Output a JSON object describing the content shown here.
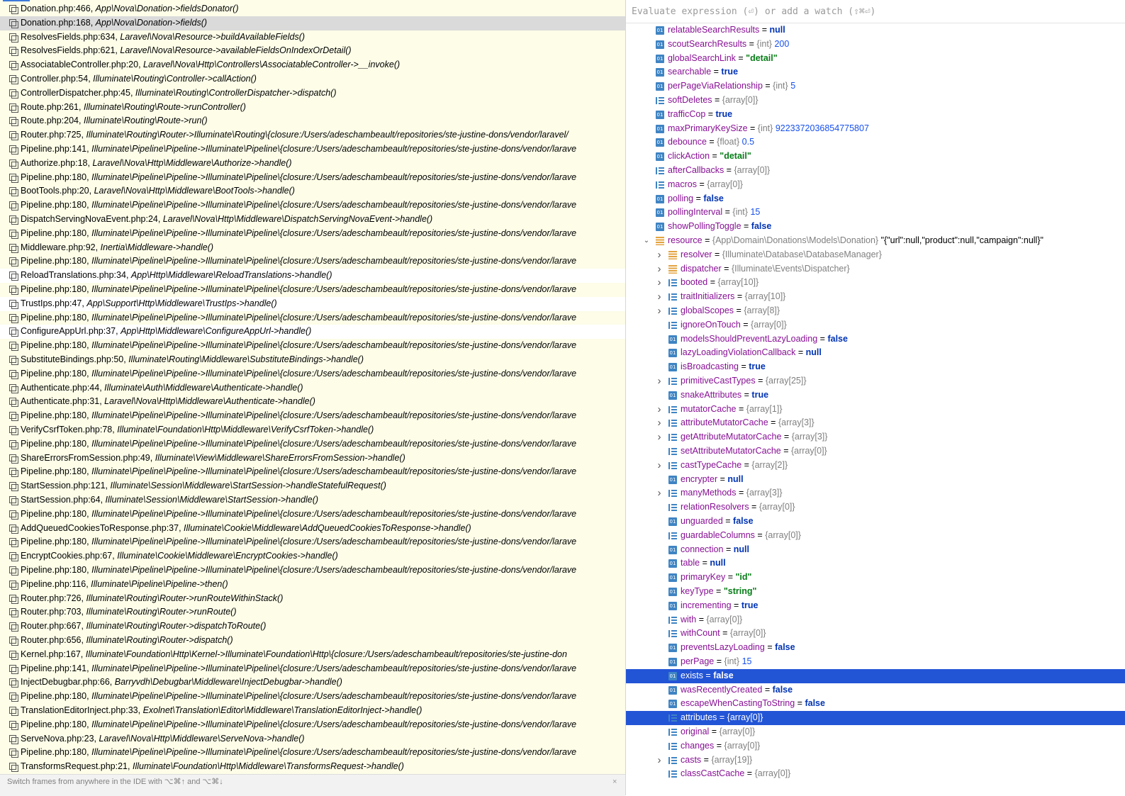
{
  "frames": [
    {
      "file": "Donation.php:466,",
      "method": "App\\Nova\\Donation->fieldsDonator()"
    },
    {
      "file": "Donation.php:168,",
      "method": "App\\Nova\\Donation->fields()",
      "selected": true
    },
    {
      "file": "ResolvesFields.php:634,",
      "method": "Laravel\\Nova\\Resource->buildAvailableFields()"
    },
    {
      "file": "ResolvesFields.php:621,",
      "method": "Laravel\\Nova\\Resource->availableFieldsOnIndexOrDetail()"
    },
    {
      "file": "AssociatableController.php:20,",
      "method": "Laravel\\Nova\\Http\\Controllers\\AssociatableController->__invoke()"
    },
    {
      "file": "Controller.php:54,",
      "method": "Illuminate\\Routing\\Controller->callAction()"
    },
    {
      "file": "ControllerDispatcher.php:45,",
      "method": "Illuminate\\Routing\\ControllerDispatcher->dispatch()"
    },
    {
      "file": "Route.php:261,",
      "method": "Illuminate\\Routing\\Route->runController()"
    },
    {
      "file": "Route.php:204,",
      "method": "Illuminate\\Routing\\Route->run()"
    },
    {
      "file": "Router.php:725,",
      "method": "Illuminate\\Routing\\Router->Illuminate\\Routing\\{closure:/Users/adeschambeault/repositories/ste-justine-dons/vendor/laravel/"
    },
    {
      "file": "Pipeline.php:141,",
      "method": "Illuminate\\Pipeline\\Pipeline->Illuminate\\Pipeline\\{closure:/Users/adeschambeault/repositories/ste-justine-dons/vendor/larave"
    },
    {
      "file": "Authorize.php:18,",
      "method": "Laravel\\Nova\\Http\\Middleware\\Authorize->handle()"
    },
    {
      "file": "Pipeline.php:180,",
      "method": "Illuminate\\Pipeline\\Pipeline->Illuminate\\Pipeline\\{closure:/Users/adeschambeault/repositories/ste-justine-dons/vendor/larave"
    },
    {
      "file": "BootTools.php:20,",
      "method": "Laravel\\Nova\\Http\\Middleware\\BootTools->handle()"
    },
    {
      "file": "Pipeline.php:180,",
      "method": "Illuminate\\Pipeline\\Pipeline->Illuminate\\Pipeline\\{closure:/Users/adeschambeault/repositories/ste-justine-dons/vendor/larave"
    },
    {
      "file": "DispatchServingNovaEvent.php:24,",
      "method": "Laravel\\Nova\\Http\\Middleware\\DispatchServingNovaEvent->handle()"
    },
    {
      "file": "Pipeline.php:180,",
      "method": "Illuminate\\Pipeline\\Pipeline->Illuminate\\Pipeline\\{closure:/Users/adeschambeault/repositories/ste-justine-dons/vendor/larave"
    },
    {
      "file": "Middleware.php:92,",
      "method": "Inertia\\Middleware->handle()"
    },
    {
      "file": "Pipeline.php:180,",
      "method": "Illuminate\\Pipeline\\Pipeline->Illuminate\\Pipeline\\{closure:/Users/adeschambeault/repositories/ste-justine-dons/vendor/larave"
    },
    {
      "file": "ReloadTranslations.php:34,",
      "method": "App\\Http\\Middleware\\ReloadTranslations->handle()",
      "plain": true
    },
    {
      "file": "Pipeline.php:180,",
      "method": "Illuminate\\Pipeline\\Pipeline->Illuminate\\Pipeline\\{closure:/Users/adeschambeault/repositories/ste-justine-dons/vendor/larave"
    },
    {
      "file": "TrustIps.php:47,",
      "method": "App\\Support\\Http\\Middleware\\TrustIps->handle()",
      "plain": true
    },
    {
      "file": "Pipeline.php:180,",
      "method": "Illuminate\\Pipeline\\Pipeline->Illuminate\\Pipeline\\{closure:/Users/adeschambeault/repositories/ste-justine-dons/vendor/larave"
    },
    {
      "file": "ConfigureAppUrl.php:37,",
      "method": "App\\Http\\Middleware\\ConfigureAppUrl->handle()",
      "plain": true
    },
    {
      "file": "Pipeline.php:180,",
      "method": "Illuminate\\Pipeline\\Pipeline->Illuminate\\Pipeline\\{closure:/Users/adeschambeault/repositories/ste-justine-dons/vendor/larave"
    },
    {
      "file": "SubstituteBindings.php:50,",
      "method": "Illuminate\\Routing\\Middleware\\SubstituteBindings->handle()"
    },
    {
      "file": "Pipeline.php:180,",
      "method": "Illuminate\\Pipeline\\Pipeline->Illuminate\\Pipeline\\{closure:/Users/adeschambeault/repositories/ste-justine-dons/vendor/larave"
    },
    {
      "file": "Authenticate.php:44,",
      "method": "Illuminate\\Auth\\Middleware\\Authenticate->handle()"
    },
    {
      "file": "Authenticate.php:31,",
      "method": "Laravel\\Nova\\Http\\Middleware\\Authenticate->handle()"
    },
    {
      "file": "Pipeline.php:180,",
      "method": "Illuminate\\Pipeline\\Pipeline->Illuminate\\Pipeline\\{closure:/Users/adeschambeault/repositories/ste-justine-dons/vendor/larave"
    },
    {
      "file": "VerifyCsrfToken.php:78,",
      "method": "Illuminate\\Foundation\\Http\\Middleware\\VerifyCsrfToken->handle()"
    },
    {
      "file": "Pipeline.php:180,",
      "method": "Illuminate\\Pipeline\\Pipeline->Illuminate\\Pipeline\\{closure:/Users/adeschambeault/repositories/ste-justine-dons/vendor/larave"
    },
    {
      "file": "ShareErrorsFromSession.php:49,",
      "method": "Illuminate\\View\\Middleware\\ShareErrorsFromSession->handle()"
    },
    {
      "file": "Pipeline.php:180,",
      "method": "Illuminate\\Pipeline\\Pipeline->Illuminate\\Pipeline\\{closure:/Users/adeschambeault/repositories/ste-justine-dons/vendor/larave"
    },
    {
      "file": "StartSession.php:121,",
      "method": "Illuminate\\Session\\Middleware\\StartSession->handleStatefulRequest()"
    },
    {
      "file": "StartSession.php:64,",
      "method": "Illuminate\\Session\\Middleware\\StartSession->handle()"
    },
    {
      "file": "Pipeline.php:180,",
      "method": "Illuminate\\Pipeline\\Pipeline->Illuminate\\Pipeline\\{closure:/Users/adeschambeault/repositories/ste-justine-dons/vendor/larave"
    },
    {
      "file": "AddQueuedCookiesToResponse.php:37,",
      "method": "Illuminate\\Cookie\\Middleware\\AddQueuedCookiesToResponse->handle()"
    },
    {
      "file": "Pipeline.php:180,",
      "method": "Illuminate\\Pipeline\\Pipeline->Illuminate\\Pipeline\\{closure:/Users/adeschambeault/repositories/ste-justine-dons/vendor/larave"
    },
    {
      "file": "EncryptCookies.php:67,",
      "method": "Illuminate\\Cookie\\Middleware\\EncryptCookies->handle()"
    },
    {
      "file": "Pipeline.php:180,",
      "method": "Illuminate\\Pipeline\\Pipeline->Illuminate\\Pipeline\\{closure:/Users/adeschambeault/repositories/ste-justine-dons/vendor/larave"
    },
    {
      "file": "Pipeline.php:116,",
      "method": "Illuminate\\Pipeline\\Pipeline->then()"
    },
    {
      "file": "Router.php:726,",
      "method": "Illuminate\\Routing\\Router->runRouteWithinStack()"
    },
    {
      "file": "Router.php:703,",
      "method": "Illuminate\\Routing\\Router->runRoute()"
    },
    {
      "file": "Router.php:667,",
      "method": "Illuminate\\Routing\\Router->dispatchToRoute()"
    },
    {
      "file": "Router.php:656,",
      "method": "Illuminate\\Routing\\Router->dispatch()"
    },
    {
      "file": "Kernel.php:167,",
      "method": "Illuminate\\Foundation\\Http\\Kernel->Illuminate\\Foundation\\Http\\{closure:/Users/adeschambeault/repositories/ste-justine-don"
    },
    {
      "file": "Pipeline.php:141,",
      "method": "Illuminate\\Pipeline\\Pipeline->Illuminate\\Pipeline\\{closure:/Users/adeschambeault/repositories/ste-justine-dons/vendor/larave"
    },
    {
      "file": "InjectDebugbar.php:66,",
      "method": "Barryvdh\\Debugbar\\Middleware\\InjectDebugbar->handle()"
    },
    {
      "file": "Pipeline.php:180,",
      "method": "Illuminate\\Pipeline\\Pipeline->Illuminate\\Pipeline\\{closure:/Users/adeschambeault/repositories/ste-justine-dons/vendor/larave"
    },
    {
      "file": "TranslationEditorInject.php:33,",
      "method": "Exolnet\\Translation\\Editor\\Middleware\\TranslationEditorInject->handle()"
    },
    {
      "file": "Pipeline.php:180,",
      "method": "Illuminate\\Pipeline\\Pipeline->Illuminate\\Pipeline\\{closure:/Users/adeschambeault/repositories/ste-justine-dons/vendor/larave"
    },
    {
      "file": "ServeNova.php:23,",
      "method": "Laravel\\Nova\\Http\\Middleware\\ServeNova->handle()"
    },
    {
      "file": "Pipeline.php:180,",
      "method": "Illuminate\\Pipeline\\Pipeline->Illuminate\\Pipeline\\{closure:/Users/adeschambeault/repositories/ste-justine-dons/vendor/larave"
    },
    {
      "file": "TransformsRequest.php:21,",
      "method": "Illuminate\\Foundation\\Http\\Middleware\\TransformsRequest->handle()"
    }
  ],
  "status_hint": "Switch frames from anywhere in the IDE with ⌥⌘↑ and ⌥⌘↓",
  "close_icon": "×",
  "eval_placeholder": "Evaluate expression (⏎) or add a watch (⇧⌘⏎)",
  "variables": [
    {
      "name": "relatableSearchResults",
      "icon": "prim",
      "value": "null",
      "vkind": "null",
      "level": 0
    },
    {
      "name": "scoutSearchResults",
      "icon": "prim",
      "type": "{int}",
      "value": "200",
      "vkind": "num",
      "level": 0
    },
    {
      "name": "globalSearchLink",
      "icon": "prim",
      "value": "\"detail\"",
      "vkind": "str",
      "level": 0
    },
    {
      "name": "searchable",
      "icon": "prim",
      "value": "true",
      "vkind": "bool",
      "level": 0
    },
    {
      "name": "perPageViaRelationship",
      "icon": "prim",
      "type": "{int}",
      "value": "5",
      "vkind": "num",
      "level": 0
    },
    {
      "name": "softDeletes",
      "icon": "arr",
      "value": "{array[0]}",
      "vkind": "plain",
      "level": 0
    },
    {
      "name": "trafficCop",
      "icon": "prim",
      "value": "true",
      "vkind": "bool",
      "level": 0
    },
    {
      "name": "maxPrimaryKeySize",
      "icon": "prim",
      "type": "{int}",
      "value": "9223372036854775807",
      "vkind": "num",
      "level": 0
    },
    {
      "name": "debounce",
      "icon": "prim",
      "type": "{float}",
      "value": "0.5",
      "vkind": "num",
      "level": 0
    },
    {
      "name": "clickAction",
      "icon": "prim",
      "value": "\"detail\"",
      "vkind": "str",
      "level": 0
    },
    {
      "name": "afterCallbacks",
      "icon": "arr",
      "value": "{array[0]}",
      "vkind": "plain",
      "level": 0
    },
    {
      "name": "macros",
      "icon": "arr",
      "value": "{array[0]}",
      "vkind": "plain",
      "level": 0
    },
    {
      "name": "polling",
      "icon": "prim",
      "value": "false",
      "vkind": "bool",
      "level": 0
    },
    {
      "name": "pollingInterval",
      "icon": "prim",
      "type": "{int}",
      "value": "15",
      "vkind": "num",
      "level": 0
    },
    {
      "name": "showPollingToggle",
      "icon": "prim",
      "value": "false",
      "vkind": "bool",
      "level": 0
    },
    {
      "name": "resource",
      "icon": "obj",
      "type": "{App\\Domain\\Donations\\Models\\Donation}",
      "value": "\"{\"url\":null,\"product\":null,\"campaign\":null}\"",
      "vkind": "strlight",
      "level": 0,
      "arrow": "expanded"
    },
    {
      "name": "resolver",
      "icon": "obj",
      "value": "{Illuminate\\Database\\DatabaseManager}",
      "vkind": "plain",
      "level": 1,
      "arrow": "collapsed"
    },
    {
      "name": "dispatcher",
      "icon": "obj",
      "value": "{Illuminate\\Events\\Dispatcher}",
      "vkind": "plain",
      "level": 1,
      "arrow": "collapsed"
    },
    {
      "name": "booted",
      "icon": "arr",
      "value": "{array[10]}",
      "vkind": "plain",
      "level": 1,
      "arrow": "collapsed"
    },
    {
      "name": "traitInitializers",
      "icon": "arr",
      "value": "{array[10]}",
      "vkind": "plain",
      "level": 1,
      "arrow": "collapsed"
    },
    {
      "name": "globalScopes",
      "icon": "arr",
      "value": "{array[8]}",
      "vkind": "plain",
      "level": 1,
      "arrow": "collapsed"
    },
    {
      "name": "ignoreOnTouch",
      "icon": "arr",
      "value": "{array[0]}",
      "vkind": "plain",
      "level": 1
    },
    {
      "name": "modelsShouldPreventLazyLoading",
      "icon": "prim",
      "value": "false",
      "vkind": "bool",
      "level": 1
    },
    {
      "name": "lazyLoadingViolationCallback",
      "icon": "prim",
      "value": "null",
      "vkind": "null",
      "level": 1
    },
    {
      "name": "isBroadcasting",
      "icon": "prim",
      "value": "true",
      "vkind": "bool",
      "level": 1
    },
    {
      "name": "primitiveCastTypes",
      "icon": "arr",
      "value": "{array[25]}",
      "vkind": "plain",
      "level": 1,
      "arrow": "collapsed"
    },
    {
      "name": "snakeAttributes",
      "icon": "prim",
      "value": "true",
      "vkind": "bool",
      "level": 1
    },
    {
      "name": "mutatorCache",
      "icon": "arr",
      "value": "{array[1]}",
      "vkind": "plain",
      "level": 1,
      "arrow": "collapsed"
    },
    {
      "name": "attributeMutatorCache",
      "icon": "arr",
      "value": "{array[3]}",
      "vkind": "plain",
      "level": 1,
      "arrow": "collapsed"
    },
    {
      "name": "getAttributeMutatorCache",
      "icon": "arr",
      "value": "{array[3]}",
      "vkind": "plain",
      "level": 1,
      "arrow": "collapsed"
    },
    {
      "name": "setAttributeMutatorCache",
      "icon": "arr",
      "value": "{array[0]}",
      "vkind": "plain",
      "level": 1
    },
    {
      "name": "castTypeCache",
      "icon": "arr",
      "value": "{array[2]}",
      "vkind": "plain",
      "level": 1,
      "arrow": "collapsed"
    },
    {
      "name": "encrypter",
      "icon": "prim",
      "value": "null",
      "vkind": "null",
      "level": 1
    },
    {
      "name": "manyMethods",
      "icon": "arr",
      "value": "{array[3]}",
      "vkind": "plain",
      "level": 1,
      "arrow": "collapsed"
    },
    {
      "name": "relationResolvers",
      "icon": "arr",
      "value": "{array[0]}",
      "vkind": "plain",
      "level": 1
    },
    {
      "name": "unguarded",
      "icon": "prim",
      "value": "false",
      "vkind": "bool",
      "level": 1
    },
    {
      "name": "guardableColumns",
      "icon": "arr",
      "value": "{array[0]}",
      "vkind": "plain",
      "level": 1
    },
    {
      "name": "connection",
      "icon": "prim",
      "value": "null",
      "vkind": "null",
      "level": 1
    },
    {
      "name": "table",
      "icon": "prim",
      "value": "null",
      "vkind": "null",
      "level": 1
    },
    {
      "name": "primaryKey",
      "icon": "prim",
      "value": "\"id\"",
      "vkind": "str",
      "level": 1
    },
    {
      "name": "keyType",
      "icon": "prim",
      "value": "\"string\"",
      "vkind": "str",
      "level": 1
    },
    {
      "name": "incrementing",
      "icon": "prim",
      "value": "true",
      "vkind": "bool",
      "level": 1
    },
    {
      "name": "with",
      "icon": "arr",
      "value": "{array[0]}",
      "vkind": "plain",
      "level": 1
    },
    {
      "name": "withCount",
      "icon": "arr",
      "value": "{array[0]}",
      "vkind": "plain",
      "level": 1
    },
    {
      "name": "preventsLazyLoading",
      "icon": "prim",
      "value": "false",
      "vkind": "bool",
      "level": 1
    },
    {
      "name": "perPage",
      "icon": "prim",
      "type": "{int}",
      "value": "15",
      "vkind": "num",
      "level": 1
    },
    {
      "name": "exists",
      "icon": "prim",
      "value": "false",
      "vkind": "bool",
      "level": 1,
      "selected": true
    },
    {
      "name": "wasRecentlyCreated",
      "icon": "prim",
      "value": "false",
      "vkind": "bool",
      "level": 1
    },
    {
      "name": "escapeWhenCastingToString",
      "icon": "prim",
      "value": "false",
      "vkind": "bool",
      "level": 1
    },
    {
      "name": "attributes",
      "icon": "arr",
      "value": "{array[0]}",
      "vkind": "plain",
      "level": 1,
      "selected": true
    },
    {
      "name": "original",
      "icon": "arr",
      "value": "{array[0]}",
      "vkind": "plain",
      "level": 1
    },
    {
      "name": "changes",
      "icon": "arr",
      "value": "{array[0]}",
      "vkind": "plain",
      "level": 1
    },
    {
      "name": "casts",
      "icon": "arr",
      "value": "{array[19]}",
      "vkind": "plain",
      "level": 1,
      "arrow": "collapsed"
    },
    {
      "name": "classCastCache",
      "icon": "arr",
      "value": "{array[0]}",
      "vkind": "plain",
      "level": 1
    }
  ],
  "colors": {
    "selection": "#2254d6",
    "frames_bg": "#fdfde8",
    "selected_frame": "#dadada"
  }
}
